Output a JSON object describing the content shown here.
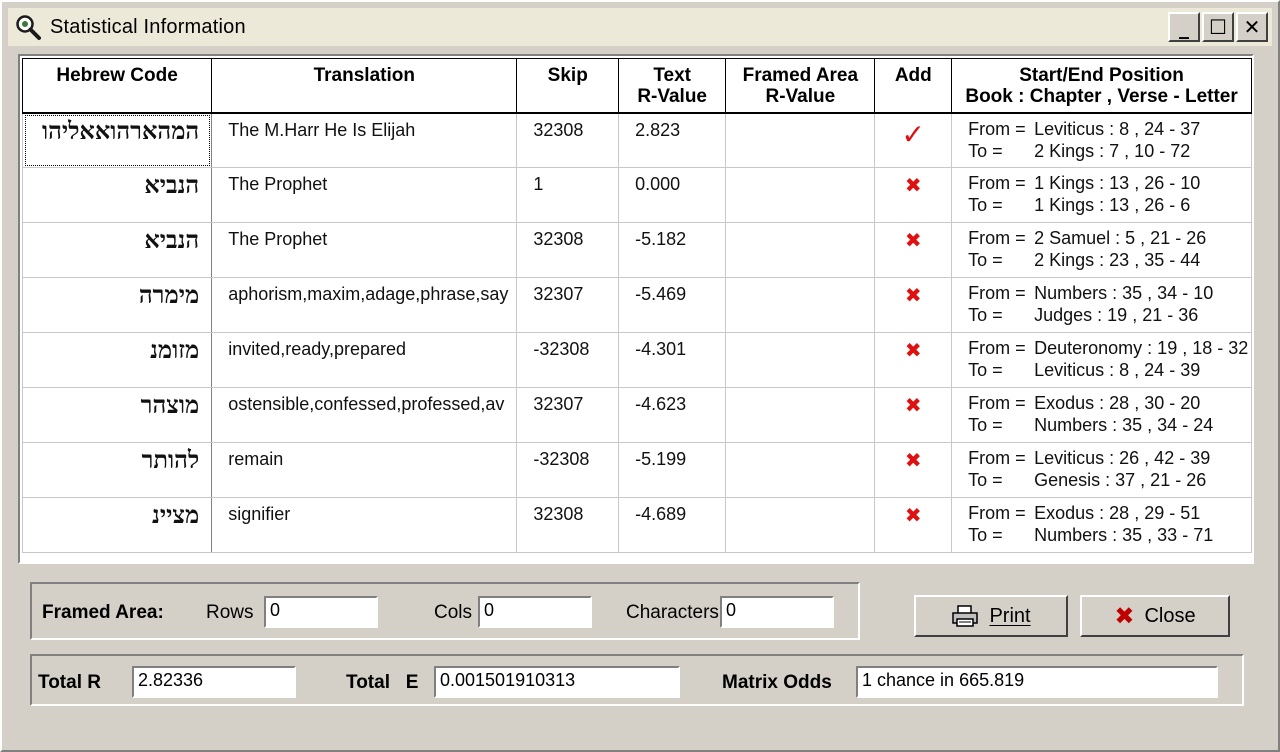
{
  "window": {
    "title": "Statistical Information",
    "buttons": {
      "minimize": "_",
      "maximize": "☐",
      "close": "✕"
    }
  },
  "grid": {
    "columns": [
      "Hebrew Code",
      "Translation",
      "Skip",
      "Text\nR-Value",
      "Framed Area\nR-Value",
      "Add",
      "Start/End Position\nBook : Chapter , Verse - Letter"
    ],
    "rows": [
      {
        "hebrew": "המהארהואאליהו",
        "translation": "The M.Harr He Is Elijah",
        "skip": "32308",
        "text_r": "2.823",
        "framed_r": "",
        "add": true,
        "from": "Leviticus : 8 , 24 - 37",
        "to": "2 Kings : 7 , 10 - 72"
      },
      {
        "hebrew": "הנביא",
        "translation": "The Prophet",
        "skip": "1",
        "text_r": "0.000",
        "framed_r": "",
        "add": false,
        "from": "1 Kings : 13 , 26 - 10",
        "to": "1 Kings : 13 , 26 - 6"
      },
      {
        "hebrew": "הנביא",
        "translation": "The Prophet",
        "skip": "32308",
        "text_r": "-5.182",
        "framed_r": "",
        "add": false,
        "from": "2 Samuel : 5 , 21 - 26",
        "to": "2 Kings : 23 , 35 - 44"
      },
      {
        "hebrew": "מימרה",
        "translation": "aphorism,maxim,adage,phrase,say",
        "skip": "32307",
        "text_r": "-5.469",
        "framed_r": "",
        "add": false,
        "from": "Numbers : 35 , 34 - 10",
        "to": "Judges : 19 , 21 - 36"
      },
      {
        "hebrew": "מזומנ",
        "translation": "invited,ready,prepared",
        "skip": "-32308",
        "text_r": "-4.301",
        "framed_r": "",
        "add": false,
        "from": "Deuteronomy : 19 , 18 - 32",
        "to": "Leviticus : 8 , 24 - 39"
      },
      {
        "hebrew": "מוצהר",
        "translation": "ostensible,confessed,professed,av",
        "skip": "32307",
        "text_r": "-4.623",
        "framed_r": "",
        "add": false,
        "from": "Exodus : 28 , 30 - 20",
        "to": "Numbers : 35 , 34 - 24"
      },
      {
        "hebrew": "להותר",
        "translation": "remain",
        "skip": "-32308",
        "text_r": "-5.199",
        "framed_r": "",
        "add": false,
        "from": "Leviticus : 26 , 42 - 39",
        "to": "Genesis : 37 , 21 - 26"
      },
      {
        "hebrew": "מציינ",
        "translation": "signifier",
        "skip": "32308",
        "text_r": "-4.689",
        "framed_r": "",
        "add": false,
        "from": "Exodus : 28 , 29 - 51",
        "to": "Numbers : 35 , 33 - 71"
      }
    ],
    "from_label": "From =",
    "to_label": "To =",
    "add_marks": {
      "checked": "✓",
      "unchecked": "✖"
    },
    "mark_color": "#e01010"
  },
  "framed_area": {
    "label": "Framed Area:",
    "rows_label": "Rows",
    "rows_value": "0",
    "cols_label": "Cols",
    "cols_value": "0",
    "chars_label": "Characters",
    "chars_value": "0"
  },
  "buttons": {
    "print": "Print",
    "close": "Close"
  },
  "totals": {
    "total_r_label": "Total R",
    "total_r_value": "2.82336",
    "total_e_label": "Total   E",
    "total_e_value": "0.001501910313",
    "odds_label": "Matrix Odds",
    "odds_value": "1 chance in 665.819"
  }
}
